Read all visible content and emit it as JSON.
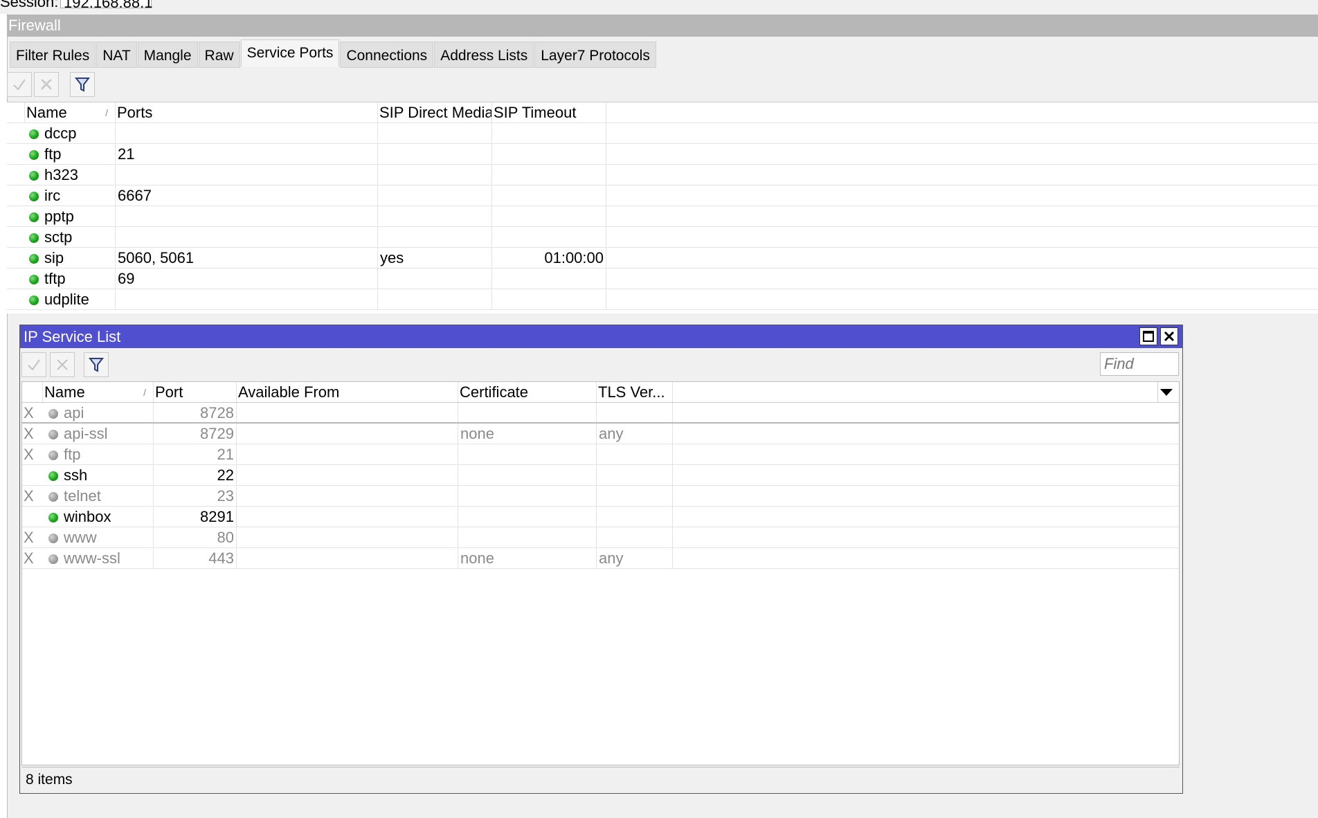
{
  "session": {
    "label": "Session:",
    "value": "192.168.88.1"
  },
  "firewall": {
    "title": "Firewall",
    "tabs": [
      {
        "label": "Filter Rules",
        "active": false
      },
      {
        "label": "NAT",
        "active": false
      },
      {
        "label": "Mangle",
        "active": false
      },
      {
        "label": "Raw",
        "active": false
      },
      {
        "label": "Service Ports",
        "active": true
      },
      {
        "label": "Connections",
        "active": false
      },
      {
        "label": "Address Lists",
        "active": false
      },
      {
        "label": "Layer7 Protocols",
        "active": false
      }
    ],
    "toolbar": [
      "enable-icon",
      "disable-icon",
      "filter-icon"
    ],
    "columns": [
      "Name",
      "Ports",
      "SIP Direct Media",
      "SIP Timeout"
    ],
    "rows": [
      {
        "name": "dccp",
        "ports": "",
        "sip_direct_media": "",
        "sip_timeout": ""
      },
      {
        "name": "ftp",
        "ports": "21",
        "sip_direct_media": "",
        "sip_timeout": ""
      },
      {
        "name": "h323",
        "ports": "",
        "sip_direct_media": "",
        "sip_timeout": ""
      },
      {
        "name": "irc",
        "ports": "6667",
        "sip_direct_media": "",
        "sip_timeout": ""
      },
      {
        "name": "pptp",
        "ports": "",
        "sip_direct_media": "",
        "sip_timeout": ""
      },
      {
        "name": "sctp",
        "ports": "",
        "sip_direct_media": "",
        "sip_timeout": ""
      },
      {
        "name": "sip",
        "ports": "5060, 5061",
        "sip_direct_media": "yes",
        "sip_timeout": "01:00:00"
      },
      {
        "name": "tftp",
        "ports": "69",
        "sip_direct_media": "",
        "sip_timeout": ""
      },
      {
        "name": "udplite",
        "ports": "",
        "sip_direct_media": "",
        "sip_timeout": ""
      }
    ]
  },
  "ip_service": {
    "title": "IP Service List",
    "find_placeholder": "Find",
    "columns": [
      "Name",
      "Port",
      "Available From",
      "Certificate",
      "TLS Ver..."
    ],
    "rows": [
      {
        "flag": "X",
        "name": "api",
        "port": "8728",
        "available_from": "",
        "certificate": "",
        "tls": "",
        "enabled": false
      },
      {
        "flag": "X",
        "name": "api-ssl",
        "port": "8729",
        "available_from": "",
        "certificate": "none",
        "tls": "any",
        "enabled": false
      },
      {
        "flag": "X",
        "name": "ftp",
        "port": "21",
        "available_from": "",
        "certificate": "",
        "tls": "",
        "enabled": false
      },
      {
        "flag": "",
        "name": "ssh",
        "port": "22",
        "available_from": "",
        "certificate": "",
        "tls": "",
        "enabled": true
      },
      {
        "flag": "X",
        "name": "telnet",
        "port": "23",
        "available_from": "",
        "certificate": "",
        "tls": "",
        "enabled": false
      },
      {
        "flag": "",
        "name": "winbox",
        "port": "8291",
        "available_from": "",
        "certificate": "",
        "tls": "",
        "enabled": true
      },
      {
        "flag": "X",
        "name": "www",
        "port": "80",
        "available_from": "",
        "certificate": "",
        "tls": "",
        "enabled": false
      },
      {
        "flag": "X",
        "name": "www-ssl",
        "port": "443",
        "available_from": "",
        "certificate": "none",
        "tls": "any",
        "enabled": false
      }
    ],
    "status": "8 items"
  },
  "colors": {
    "title_bar": "#4f4fd0",
    "firewall_title": "#b7b7b7",
    "enabled_dot": "#1aa51a",
    "disabled_dot": "#9a9a9a"
  }
}
